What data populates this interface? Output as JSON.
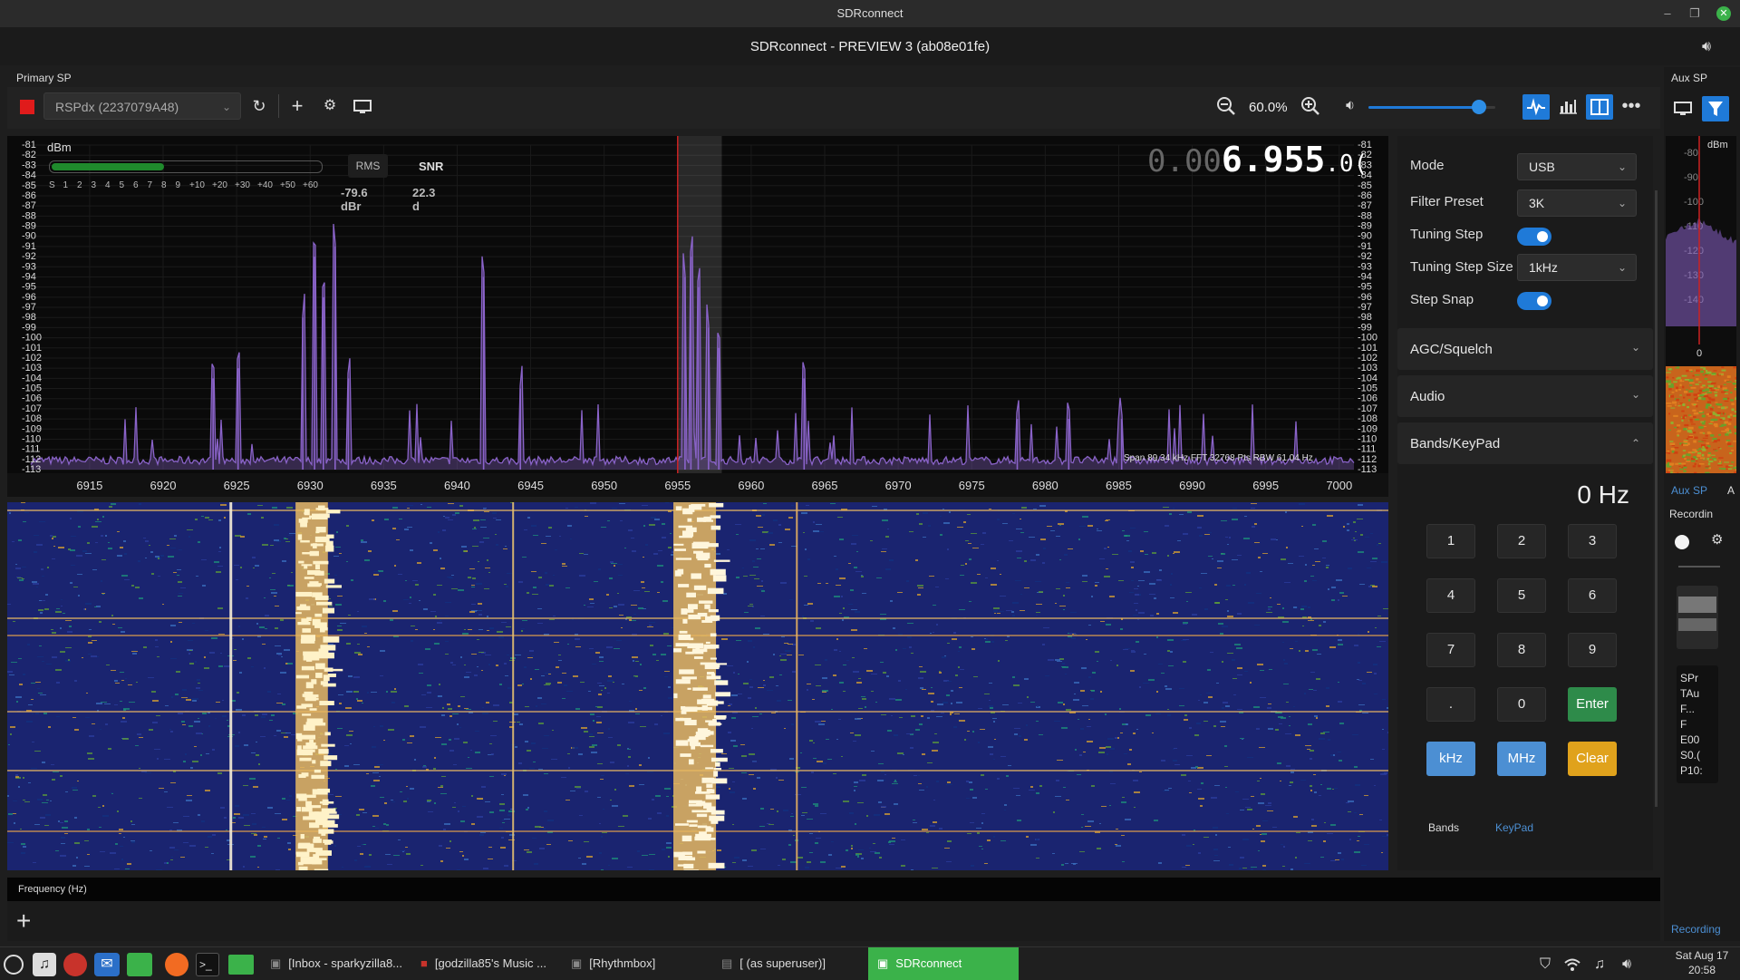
{
  "os": {
    "window_title": "SDRconnect"
  },
  "app": {
    "title": "SDRconnect - PREVIEW 3 (ab08e01fe)"
  },
  "primary": {
    "label": "Primary SP",
    "device": "RSPdx (2237079A48)",
    "zoom": "60.0%",
    "volume_level": 0.87,
    "smeter": {
      "unit": "dBm",
      "scale": [
        "S",
        "1",
        "2",
        "3",
        "4",
        "5",
        "6",
        "7",
        "8",
        "9",
        "+10",
        "+20",
        "+30",
        "+40",
        "+50",
        "+60"
      ],
      "rms_label": "RMS",
      "snr_label": "SNR",
      "rms_value": "-79.6 dBr",
      "snr_value": "22.3 d",
      "level": 0.42
    },
    "frequency_dim": "0.00",
    "frequency_main": "6.955",
    "frequency_tail": ".0(",
    "fft_info": "Span 89.34 kHz  FFT 32768 Pts  RBW 61.04 Hz",
    "frequency_axis_label": "Frequency (Hz)"
  },
  "chart_data": {
    "type": "line",
    "title": "",
    "xlabel": "",
    "ylabel": "",
    "x_ticks": [
      "6915",
      "6920",
      "6925",
      "6930",
      "6935",
      "6940",
      "6945",
      "6950",
      "6955",
      "6960",
      "6965",
      "6970",
      "6975",
      "6980",
      "6985",
      "6990",
      "6995",
      "7000"
    ],
    "y_ticks": [
      "-81",
      "-82",
      "-83",
      "-84",
      "-85",
      "-86",
      "-87",
      "-88",
      "-89",
      "-90",
      "-91",
      "-92",
      "-93",
      "-94",
      "-95",
      "-96",
      "-97",
      "-98",
      "-99",
      "-100",
      "-101",
      "-102",
      "-103",
      "-104",
      "-105",
      "-106",
      "-107",
      "-108",
      "-109",
      "-110",
      "-111",
      "-112",
      "-113"
    ],
    "xlim": [
      6911,
      7001
    ],
    "ylim": [
      -113,
      -81
    ],
    "tuned_frequency": 6955,
    "peaks": [
      {
        "x": 6923.4,
        "y": -104
      },
      {
        "x": 6925.1,
        "y": -103
      },
      {
        "x": 6929.5,
        "y": -98
      },
      {
        "x": 6930.3,
        "y": -92
      },
      {
        "x": 6930.9,
        "y": -96
      },
      {
        "x": 6931.7,
        "y": -91
      },
      {
        "x": 6932.6,
        "y": -104
      },
      {
        "x": 6941.8,
        "y": -94
      },
      {
        "x": 6944.3,
        "y": -105
      },
      {
        "x": 6955.5,
        "y": -94
      },
      {
        "x": 6955.9,
        "y": -92
      },
      {
        "x": 6956.4,
        "y": -95
      },
      {
        "x": 6957.1,
        "y": -99
      },
      {
        "x": 6957.8,
        "y": -101
      },
      {
        "x": 6963.6,
        "y": -104
      },
      {
        "x": 6978.1,
        "y": -108
      },
      {
        "x": 6981.6,
        "y": -108
      },
      {
        "x": 6985.2,
        "y": -108
      }
    ]
  },
  "controls": {
    "mode_label": "Mode",
    "mode_value": "USB",
    "filter_label": "Filter Preset",
    "filter_value": "3K",
    "tuning_step_label": "Tuning Step",
    "tuning_step_size_label": "Tuning Step Size",
    "tuning_step_size_value": "1kHz",
    "step_snap_label": "Step Snap",
    "sections": [
      "AGC/Squelch",
      "Audio",
      "Bands/KeyPad"
    ],
    "keypad_display": "0 Hz",
    "keys": [
      "1",
      "2",
      "3",
      "4",
      "5",
      "6",
      "7",
      "8",
      "9",
      ".",
      "0",
      "Enter"
    ],
    "unit_keys": [
      "kHz",
      "MHz",
      "Clear"
    ],
    "tabs": [
      "Bands",
      "KeyPad"
    ]
  },
  "aux": {
    "label": "Aux SP",
    "dbm_label": "dBm",
    "y_ticks": [
      "-80",
      "-90",
      "-100",
      "-110",
      "-120",
      "-130",
      "-140"
    ],
    "zero_label": "0",
    "tab_label": "Aux SP",
    "tab_label_2": "A",
    "recording_label": "Recordin",
    "info_lines": [
      "SPr",
      "TAu",
      "F...",
      "F",
      "E00",
      "S0.(",
      "P10:"
    ],
    "recording_tab": "Recording"
  },
  "taskbar": {
    "windows": [
      "[Inbox - sparkyzilla8...",
      "[godzilla85's Music ...",
      "[Rhythmbox]",
      "[ (as superuser)]",
      "SDRconnect"
    ],
    "clock_date": "Sat Aug 17",
    "clock_time": "20:58"
  },
  "colors": {
    "accent": "#1f7ad8",
    "enter": "#2e8b4a",
    "clear": "#e0a21c",
    "unit_key": "#4c8fd3",
    "trace": "#8a63c9",
    "tuning_line": "#cc2222"
  }
}
